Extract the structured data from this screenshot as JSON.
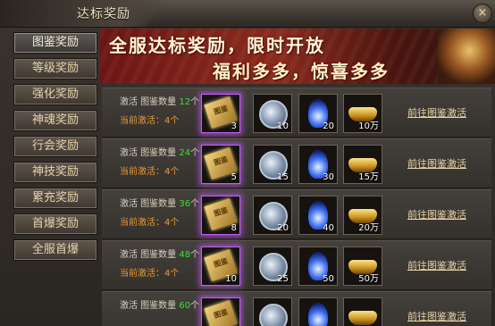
{
  "window": {
    "title": "达标奖励",
    "close_symbol": "×"
  },
  "sidebar": {
    "items": [
      {
        "label": "图鉴奖励",
        "active": true
      },
      {
        "label": "等级奖励",
        "active": false
      },
      {
        "label": "强化奖励",
        "active": false
      },
      {
        "label": "神魂奖励",
        "active": false
      },
      {
        "label": "行会奖励",
        "active": false
      },
      {
        "label": "神技奖励",
        "active": false
      },
      {
        "label": "累充奖励",
        "active": false
      },
      {
        "label": "首爆奖励",
        "active": false
      },
      {
        "label": "全服首爆",
        "active": false
      }
    ]
  },
  "banner": {
    "line1": "全服达标奖励，限时开放",
    "line2": "福利多多，惊喜多多"
  },
  "rows": [
    {
      "prefix": "激活 图鉴数量 ",
      "count": "12",
      "suffix": "个",
      "current": "当前激活：4个",
      "rewards": [
        "3",
        "10",
        "20",
        "10万"
      ],
      "goto": "前往图鉴激活"
    },
    {
      "prefix": "激活 图鉴数量 ",
      "count": "24",
      "suffix": "个",
      "current": "当前激活：4个",
      "rewards": [
        "5",
        "15",
        "30",
        "15万"
      ],
      "goto": "前往图鉴激活"
    },
    {
      "prefix": "激活 图鉴数量 ",
      "count": "36",
      "suffix": "个",
      "current": "当前激活：4个",
      "rewards": [
        "8",
        "20",
        "40",
        "20万"
      ],
      "goto": "前往图鉴激活"
    },
    {
      "prefix": "激活 图鉴数量 ",
      "count": "48",
      "suffix": "个",
      "current": "当前激活：4个",
      "rewards": [
        "10",
        "25",
        "50",
        "50万"
      ],
      "goto": "前往图鉴激活"
    },
    {
      "prefix": "激活 图鉴数量 ",
      "count": "60",
      "suffix": "个",
      "current": "",
      "rewards": [
        "",
        "",
        "",
        ""
      ],
      "goto": "前往图鉴激活"
    }
  ],
  "reward_icons": [
    "book-icon",
    "compass-icon",
    "blue-flame-icon",
    "gold-ingot-icon"
  ],
  "colors": {
    "count_green": "#38e03a",
    "current_orange": "#e79a36",
    "link_gold": "#e9d5a7",
    "purple_glow": "#c55cff"
  }
}
